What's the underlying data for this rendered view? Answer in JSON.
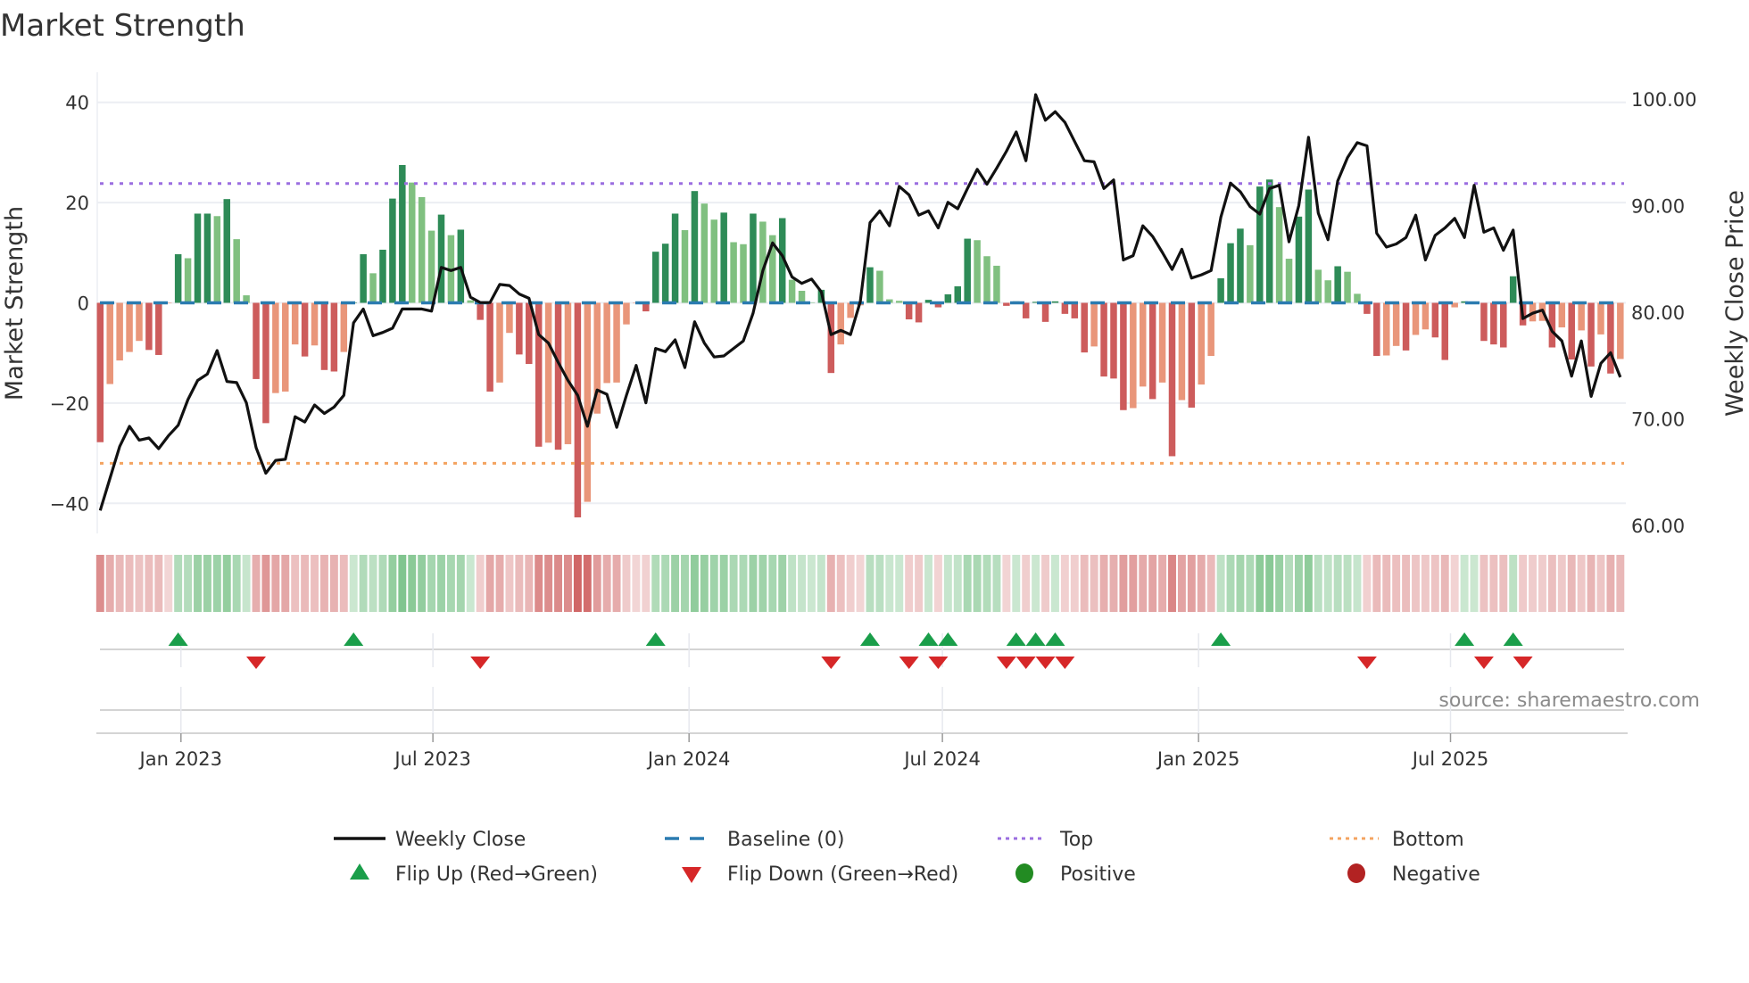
{
  "title": "Market Strength",
  "source": "source: sharemaestro.com",
  "chart_data": {
    "type": "bar+line",
    "title": "Market Strength",
    "ylabel_left": "Market Strength",
    "ylabel_right": "Weekly Close Price",
    "ylim_left": [
      -46,
      46
    ],
    "ylim_right": [
      59.25,
      102.5
    ],
    "yticks_left": [
      40,
      20,
      0,
      -20,
      -40
    ],
    "yticks_left_labels": [
      "40",
      "20",
      "0",
      "−20",
      "−40"
    ],
    "yticks_right": [
      100,
      90,
      80,
      70,
      60
    ],
    "yticks_right_labels": [
      "100.00",
      "90.00",
      "80.00",
      "70.00",
      "60.00"
    ],
    "xticks": [
      "2023-01-01",
      "2023-07-01",
      "2024-01-01",
      "2024-07-01",
      "2025-01-01",
      "2025-07-01"
    ],
    "xtick_labels": [
      "Jan 2023",
      "Jul 2023",
      "Jan 2024",
      "Jul 2024",
      "Jan 2025",
      "Jul 2025"
    ],
    "start_date": "2022-11-04",
    "interval_days": 7,
    "top_level": 23.8,
    "bottom_level": -32,
    "baseline": 0,
    "grid": true,
    "strength": [
      -27.8,
      -16.2,
      -11.5,
      -9.8,
      -7.6,
      -9.4,
      -10.4,
      -0.1,
      9.7,
      8.9,
      17.8,
      17.8,
      17.3,
      20.7,
      12.7,
      1.5,
      -15.2,
      -24,
      -18,
      -17.7,
      -8.3,
      -10.7,
      -8.5,
      -13.4,
      -13.7,
      -9.8,
      0.1,
      9.7,
      5.9,
      10.6,
      20.8,
      27.5,
      24,
      21.1,
      14.4,
      17.6,
      13.5,
      14.6,
      0.5,
      -3.4,
      -17.7,
      -15.9,
      -6,
      -10.3,
      -12.2,
      -28.7,
      -27.9,
      -29.3,
      -28.2,
      -42.8,
      -39.7,
      -22.1,
      -16,
      -15.9,
      -4.3,
      -0.1,
      -1.7,
      10.2,
      11.8,
      17.8,
      14.5,
      22.3,
      19.8,
      16.6,
      18,
      12.1,
      11.7,
      17.8,
      16.2,
      13.5,
      16.9,
      4.6,
      2.4,
      0.1,
      2.6,
      -14,
      -8.3,
      -3,
      -0.5,
      7.1,
      6.4,
      0.7,
      0.4,
      -3.3,
      -3.9,
      0.6,
      -0.9,
      1.7,
      3.3,
      12.8,
      12.5,
      9.3,
      7.4,
      -0.6,
      0.3,
      -3.1,
      0.2,
      -3.8,
      0.3,
      -2.2,
      -3.1,
      -9.9,
      -8.7,
      -14.7,
      -15.1,
      -21.4,
      -21,
      -16.7,
      -19.2,
      -15.9,
      -30.6,
      -19.4,
      -20.9,
      -16.3,
      -10.6,
      4.9,
      11.9,
      14.8,
      11.5,
      23.2,
      24.6,
      19.1,
      8.8,
      17.2,
      22.6,
      6.6,
      4.5,
      7.3,
      6.2,
      1.8,
      -2.2,
      -10.6,
      -10.5,
      -8.6,
      -9.5,
      -6.4,
      -5.3,
      -6.9,
      -11.4,
      -0.9,
      0.3,
      0.2,
      -7.6,
      -8.3,
      -8.9,
      5.3,
      -4.5,
      -3.7,
      -3.6,
      -8.9,
      -4.9,
      -11.3,
      -5.5,
      -12.7,
      -6.3,
      -14.1,
      -11.2
    ],
    "weekly_close": [
      61.4,
      64.4,
      67.4,
      69.3,
      68.0,
      68.2,
      67.2,
      68.4,
      69.4,
      71.8,
      73.6,
      74.2,
      76.4,
      73.5,
      73.4,
      71.5,
      67.3,
      64.9,
      66.1,
      66.2,
      70.2,
      69.7,
      71.3,
      70.5,
      71.1,
      72.2,
      79.0,
      80.3,
      77.8,
      78.1,
      78.5,
      80.3,
      80.3,
      80.3,
      80.1,
      84.2,
      83.9,
      84.2,
      81.4,
      80.9,
      80.9,
      82.6,
      82.5,
      81.7,
      81.3,
      77.9,
      77.1,
      75.3,
      73.6,
      72.2,
      69.3,
      72.7,
      72.3,
      69.2,
      72.2,
      75.0,
      71.5,
      76.6,
      76.3,
      77.4,
      74.8,
      79.1,
      77.1,
      75.8,
      75.9,
      76.6,
      77.3,
      79.9,
      83.9,
      86.5,
      85.3,
      83.3,
      82.7,
      83.1,
      81.9,
      77.9,
      78.3,
      77.9,
      81.0,
      88.4,
      89.5,
      88.1,
      91.8,
      91.0,
      89.1,
      89.5,
      87.9,
      90.3,
      89.7,
      91.6,
      93.4,
      92.0,
      93.5,
      95.1,
      96.9,
      94.2,
      100.4,
      98.0,
      98.8,
      97.8,
      96.0,
      94.2,
      94.1,
      91.6,
      92.4,
      84.9,
      85.3,
      88.1,
      87.1,
      85.6,
      84.0,
      85.9,
      83.2,
      83.5,
      83.9,
      88.9,
      92.1,
      91.3,
      89.9,
      89.2,
      91.6,
      91.9,
      86.6,
      90.0,
      96.4,
      89.3,
      86.8,
      92.3,
      94.5,
      95.9,
      95.6,
      87.4,
      86.1,
      86.4,
      87.0,
      89.1,
      84.9,
      87.2,
      87.9,
      88.8,
      87.0,
      91.9,
      87.5,
      87.9,
      85.8,
      87.7,
      79.4,
      79.9,
      80.2,
      78.2,
      77.3,
      74.0,
      77.3,
      72.1,
      75.2,
      76.2,
      73.9
    ],
    "legend": {
      "placement": "bottom",
      "items": [
        {
          "label": "Weekly Close",
          "symbol": "solid-line",
          "color": "#111111"
        },
        {
          "label": "Baseline (0)",
          "symbol": "dashed-line",
          "color": "#2b7bb0"
        },
        {
          "label": "Top",
          "symbol": "dotted-line",
          "color": "#9b6ee0"
        },
        {
          "label": "Bottom",
          "symbol": "dotted-line",
          "color": "#f4a460"
        },
        {
          "label": "Flip Up (Red→Green)",
          "symbol": "triangle-up",
          "color": "#1a9e4a"
        },
        {
          "label": "Flip Down (Green→Red)",
          "symbol": "triangle-down",
          "color": "#d62728"
        },
        {
          "label": "Positive",
          "symbol": "circle",
          "color": "#228b22"
        },
        {
          "label": "Negative",
          "symbol": "circle",
          "color": "#b22222"
        }
      ]
    },
    "colors": {
      "pos_strong": "#2e8b57",
      "pos_weak": "#80c080",
      "neg_strong": "#cd5c5c",
      "neg_weak": "#e9967a",
      "line": "#111111",
      "baseline": "#2b7bb0",
      "top": "#9b6ee0",
      "bottom": "#f4a460",
      "flip_up": "#1a9e4a",
      "flip_down": "#d62728",
      "grid": "#eceef3"
    }
  }
}
